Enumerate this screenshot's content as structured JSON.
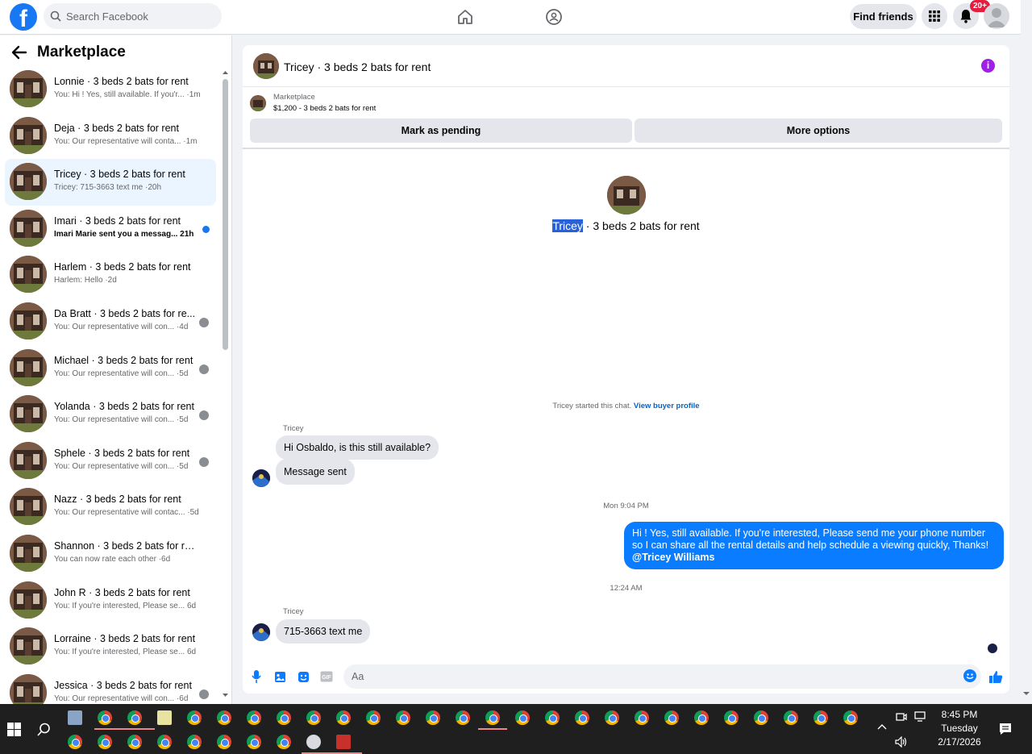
{
  "topbar": {
    "search_placeholder": "Search Facebook",
    "find_friends": "Find friends",
    "notification_count": "20+"
  },
  "sidebar": {
    "title": "Marketplace",
    "conversations": [
      {
        "name": "Lonnie · 3 beds 2 bats for rent",
        "preview": "You: Hi ! Yes, still available. If you'r... ·1m"
      },
      {
        "name": "Deja · 3 beds 2 bats for rent",
        "preview": "You: Our representative will conta... ·1m"
      },
      {
        "name": "Tricey · 3 beds 2 bats for rent",
        "preview": "Tricey: 715-3663 text me ·20h"
      },
      {
        "name": "Imari · 3 beds 2 bats for rent",
        "preview": "Imari Marie sent you a messag... 21h"
      },
      {
        "name": "Harlem · 3 beds 2 bats for rent",
        "preview": "Harlem: Hello ·2d"
      },
      {
        "name": "Da Bratt · 3 beds 2 bats for re...",
        "preview": "You: Our representative will con... ·4d"
      },
      {
        "name": "Michael · 3 beds 2 bats for rent",
        "preview": "You: Our representative will con... ·5d"
      },
      {
        "name": "Yolanda · 3 beds 2 bats for rent",
        "preview": "You: Our representative will con... ·5d"
      },
      {
        "name": "Sphele · 3 beds 2 bats for rent",
        "preview": "You: Our representative will con... ·5d"
      },
      {
        "name": "Nazz · 3 beds 2 bats for rent",
        "preview": "You: Our representative will contac... ·5d"
      },
      {
        "name": "Shannon · 3 beds 2 bats for rent",
        "preview": "You can now rate each other ·6d"
      },
      {
        "name": "John R · 3 beds 2 bats for rent",
        "preview": "You: If you're interested, Please se... 6d"
      },
      {
        "name": "Lorraine · 3 beds 2 bats for rent",
        "preview": "You: If you're interested, Please se... 6d"
      },
      {
        "name": "Jessica · 3 beds 2 bats for rent",
        "preview": "You: Our representative will con... ·6d"
      }
    ]
  },
  "chat": {
    "header_title": "Tricey · 3 beds 2 bats for rent",
    "listing_category": "Marketplace",
    "listing_desc": "$1,200 - 3 beds 2 bats for rent",
    "mark_pending": "Mark as pending",
    "more_options": "More options",
    "intro_name": "Tricey",
    "intro_rest": " · 3 beds 2 bats for rent",
    "started_text": "Tricey started this chat.",
    "view_buyer": "View buyer profile",
    "sender1": "Tricey",
    "msg1": "Hi Osbaldo, is this still available?",
    "msg2": "Message sent",
    "time1": "Mon 9:04 PM",
    "out_msg": "Hi ! Yes, still available. If you're interested, Please send me your phone number so I can share all the rental details and help schedule a viewing quickly, Thanks!",
    "out_mention": "@Tricey Williams",
    "time2": "12:24 AM",
    "sender2": "Tricey",
    "msg3": "715-3663 text me",
    "composer_placeholder": "Aa"
  },
  "taskbar": {
    "time": "8:45 PM",
    "day": "Tuesday",
    "date": "2/17/2026"
  },
  "colors": {
    "brand": "#1877f2",
    "outgoing_bubble": "#0a7cff",
    "incoming_bubble": "#e4e6eb",
    "badge": "#e41e3f"
  }
}
